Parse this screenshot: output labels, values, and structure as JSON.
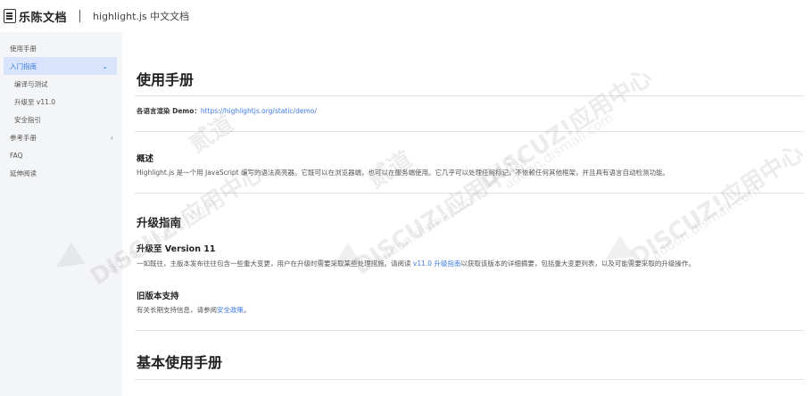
{
  "header": {
    "brand_name": "乐陈文档",
    "site_title": "highlight.js 中文文档"
  },
  "sidebar": {
    "items": [
      {
        "label": "使用手册",
        "chevron": ""
      },
      {
        "label": "入门指南",
        "chevron": "⌄"
      },
      {
        "label": "编译与测试"
      },
      {
        "label": "升级至 v11.0"
      },
      {
        "label": "安全指引"
      },
      {
        "label": "参考手册",
        "chevron": "‹"
      },
      {
        "label": "FAQ"
      },
      {
        "label": "延伸阅读"
      }
    ]
  },
  "main": {
    "title": "使用手册",
    "demo_label": "各语言渲染 Demo：",
    "demo_link": "https://highlightjs.org/static/demo/",
    "overview_heading": "概述",
    "overview_text": "Highlight.js 是一个用 JavaScript 编写的语法高亮器。它既可以在浏览器端，也可以在服务端使用。它几乎可以处理任何标记，不依赖任何其他框架，并且具有语言自动检测功能。",
    "upgrade_heading": "升级指南",
    "upgrade_sub_heading": "升级至 Version 11",
    "upgrade_text_before": "一如既往，主版本发布往往包含一些重大变更，用户在升级时需要采取某些处理措施。请阅读 ",
    "upgrade_link": "v11.0 升级指南",
    "upgrade_text_after": "以获取该版本的详细摘要，包括重大变更列表，以及可能需要采取的升级操作。",
    "legacy_heading": "旧版本支持",
    "legacy_text_before": "有关长期支持信息，请参阅",
    "legacy_link": "安全政策",
    "legacy_text_after": "。",
    "basic_heading": "基本使用手册"
  },
  "watermark": {
    "text": "DISCUZ!应用中心",
    "sub": "addon.dismall.com",
    "extra": "贰道"
  }
}
